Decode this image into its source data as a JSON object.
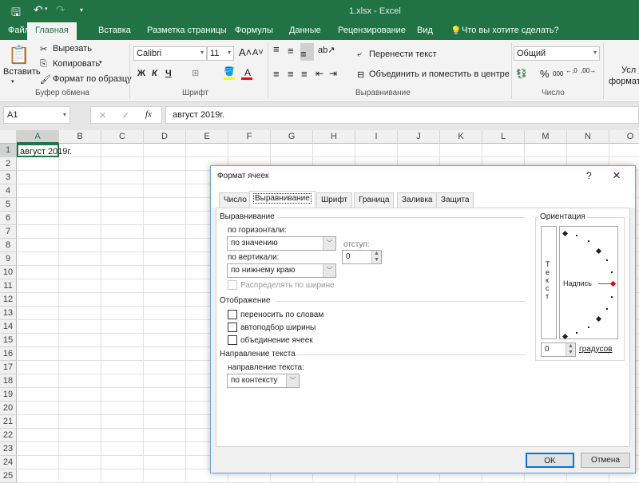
{
  "window": {
    "title": "1.xlsx - Excel"
  },
  "quick_access": {
    "save_icon": "save-icon",
    "undo_icon": "undo-icon",
    "redo_icon": "redo-icon",
    "customize_icon": "customize-icon"
  },
  "ribbon_tabs": [
    {
      "label": "Файл"
    },
    {
      "label": "Главная",
      "active": true
    },
    {
      "label": "Вставка"
    },
    {
      "label": "Разметка страницы"
    },
    {
      "label": "Формулы"
    },
    {
      "label": "Данные"
    },
    {
      "label": "Рецензирование"
    },
    {
      "label": "Вид"
    }
  ],
  "tell_me": "Что вы хотите сделать?",
  "clipboard": {
    "paste": "Вставить",
    "cut": "Вырезать",
    "copy": "Копировать",
    "format_painter": "Формат по образцу",
    "group": "Буфер обмена"
  },
  "font": {
    "name": "Calibri",
    "size": "11",
    "bold": "Ж",
    "italic": "К",
    "underline": "Ч",
    "group": "Шрифт",
    "fill_color": "#ffff00",
    "font_color": "#ff0000"
  },
  "alignment": {
    "wrap": "Перенести текст",
    "merge": "Объединить и поместить в центре",
    "group": "Выравнивание"
  },
  "number": {
    "format": "Общий",
    "percent": "%",
    "thousands": "000",
    "group": "Число"
  },
  "styles": {
    "conditional": "Усл",
    "conditional2": "формати"
  },
  "formula_bar": {
    "name_box": "A1",
    "fx": "fx",
    "value": "август 2019г."
  },
  "sheet": {
    "columns": [
      "A",
      "B",
      "C",
      "D",
      "E",
      "F",
      "G",
      "H",
      "I",
      "J",
      "K",
      "L",
      "M",
      "N",
      "O"
    ],
    "row_count": 25,
    "cells": {
      "A1": "август 2019г."
    },
    "selected": "A1"
  },
  "dialog": {
    "title": "Формат ячеек",
    "help": "?",
    "close": "×",
    "tabs": [
      "Число",
      "Выравнивание",
      "Шрифт",
      "Граница",
      "Заливка",
      "Защита"
    ],
    "active_tab": "Выравнивание",
    "section_alignment": "Выравнивание",
    "horizontal_label": "по горизонтали:",
    "horizontal_value": "по значению",
    "indent_label": "отступ:",
    "indent_value": "0",
    "vertical_label": "по вертикали:",
    "vertical_value": "по нижнему краю",
    "distribute": "Распределять по ширине",
    "section_display": "Отображение",
    "wrap_text": "переносить по словам",
    "shrink": "автоподбор ширины",
    "merge": "объединение ячеек",
    "section_direction": "Направление текста",
    "direction_label": "направление текста:",
    "direction_value": "по контексту",
    "orientation": "Ориентация",
    "vertical_text": "Текст",
    "inscription": "Надпись",
    "degrees_value": "0",
    "degrees_label": "градусов",
    "ok": "OK",
    "cancel": "Отмена"
  }
}
